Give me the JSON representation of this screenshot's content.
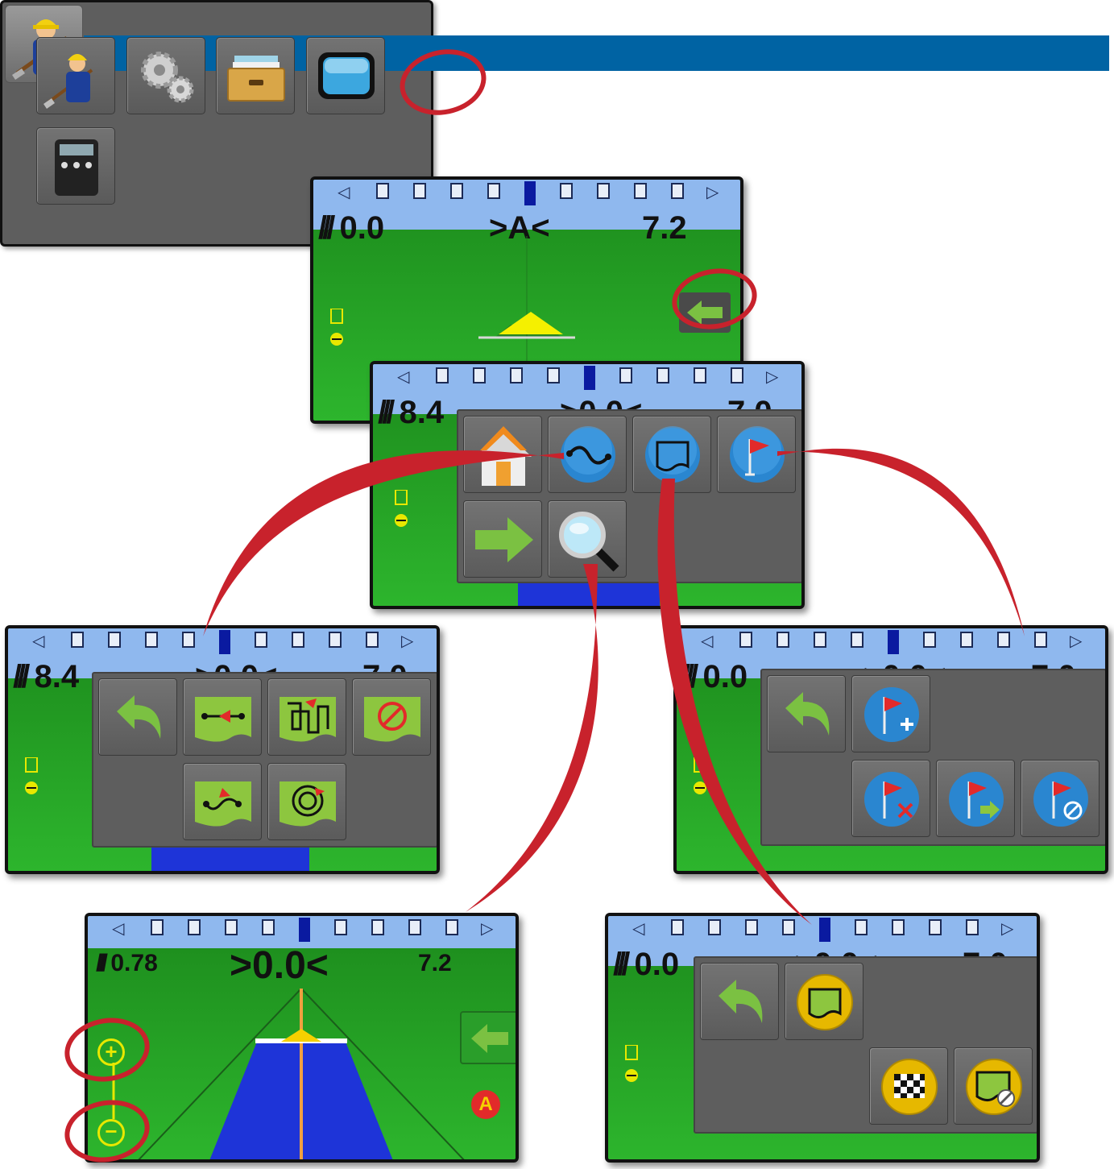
{
  "colors": {
    "title_bar": "#0063a3",
    "menu_bg": "#5e5e5e",
    "field_green": "#2a9e2a",
    "sky_blue": "#8fb8ee",
    "highlight_red": "#c8222c",
    "coverage_blue": "#1e34d8"
  },
  "icons": {
    "app": "farmer-icon",
    "main_menu": [
      "farmer-icon",
      "gears-icon",
      "file-box-icon",
      "display-icon",
      "calculator-icon"
    ],
    "nav_menu": [
      "home-icon",
      "guidance-icon",
      "boundary-icon",
      "marker-flag-icon",
      "next-arrow-icon",
      "zoom-icon"
    ],
    "guidance_submenu": [
      "back-icon",
      "straight-ab-icon",
      "adaptive-curve-icon",
      "no-guidance-icon",
      "identical-curve-icon",
      "pivot-icon"
    ],
    "marker_submenu": [
      "back-icon",
      "add-marker-icon",
      "delete-marker-icon",
      "return-to-marker-icon",
      "cancel-return-icon"
    ],
    "boundary_submenu": [
      "back-icon",
      "mark-boundary-icon",
      "finish-boundary-icon",
      "cancel-boundary-icon"
    ]
  },
  "screens": {
    "guidance": {
      "swath": "0.0",
      "xte": ">A<",
      "speed": "7.2"
    },
    "nav": {
      "swath": "8.4",
      "xte": ">0.0<",
      "speed": "7.0"
    },
    "guidance_menu": {
      "swath": "8.4",
      "xte": ">0.0<",
      "speed": "7.0"
    },
    "marker_menu": {
      "swath": "0.0",
      "xte": ">0.0<",
      "speed": "7.0"
    },
    "zoom": {
      "swath": "0.78",
      "xte": ">0.0<",
      "speed": "7.2",
      "point_label": "A"
    },
    "boundary_menu": {
      "swath": "0.0",
      "xte": ">0.0<",
      "speed": "7.0"
    }
  }
}
